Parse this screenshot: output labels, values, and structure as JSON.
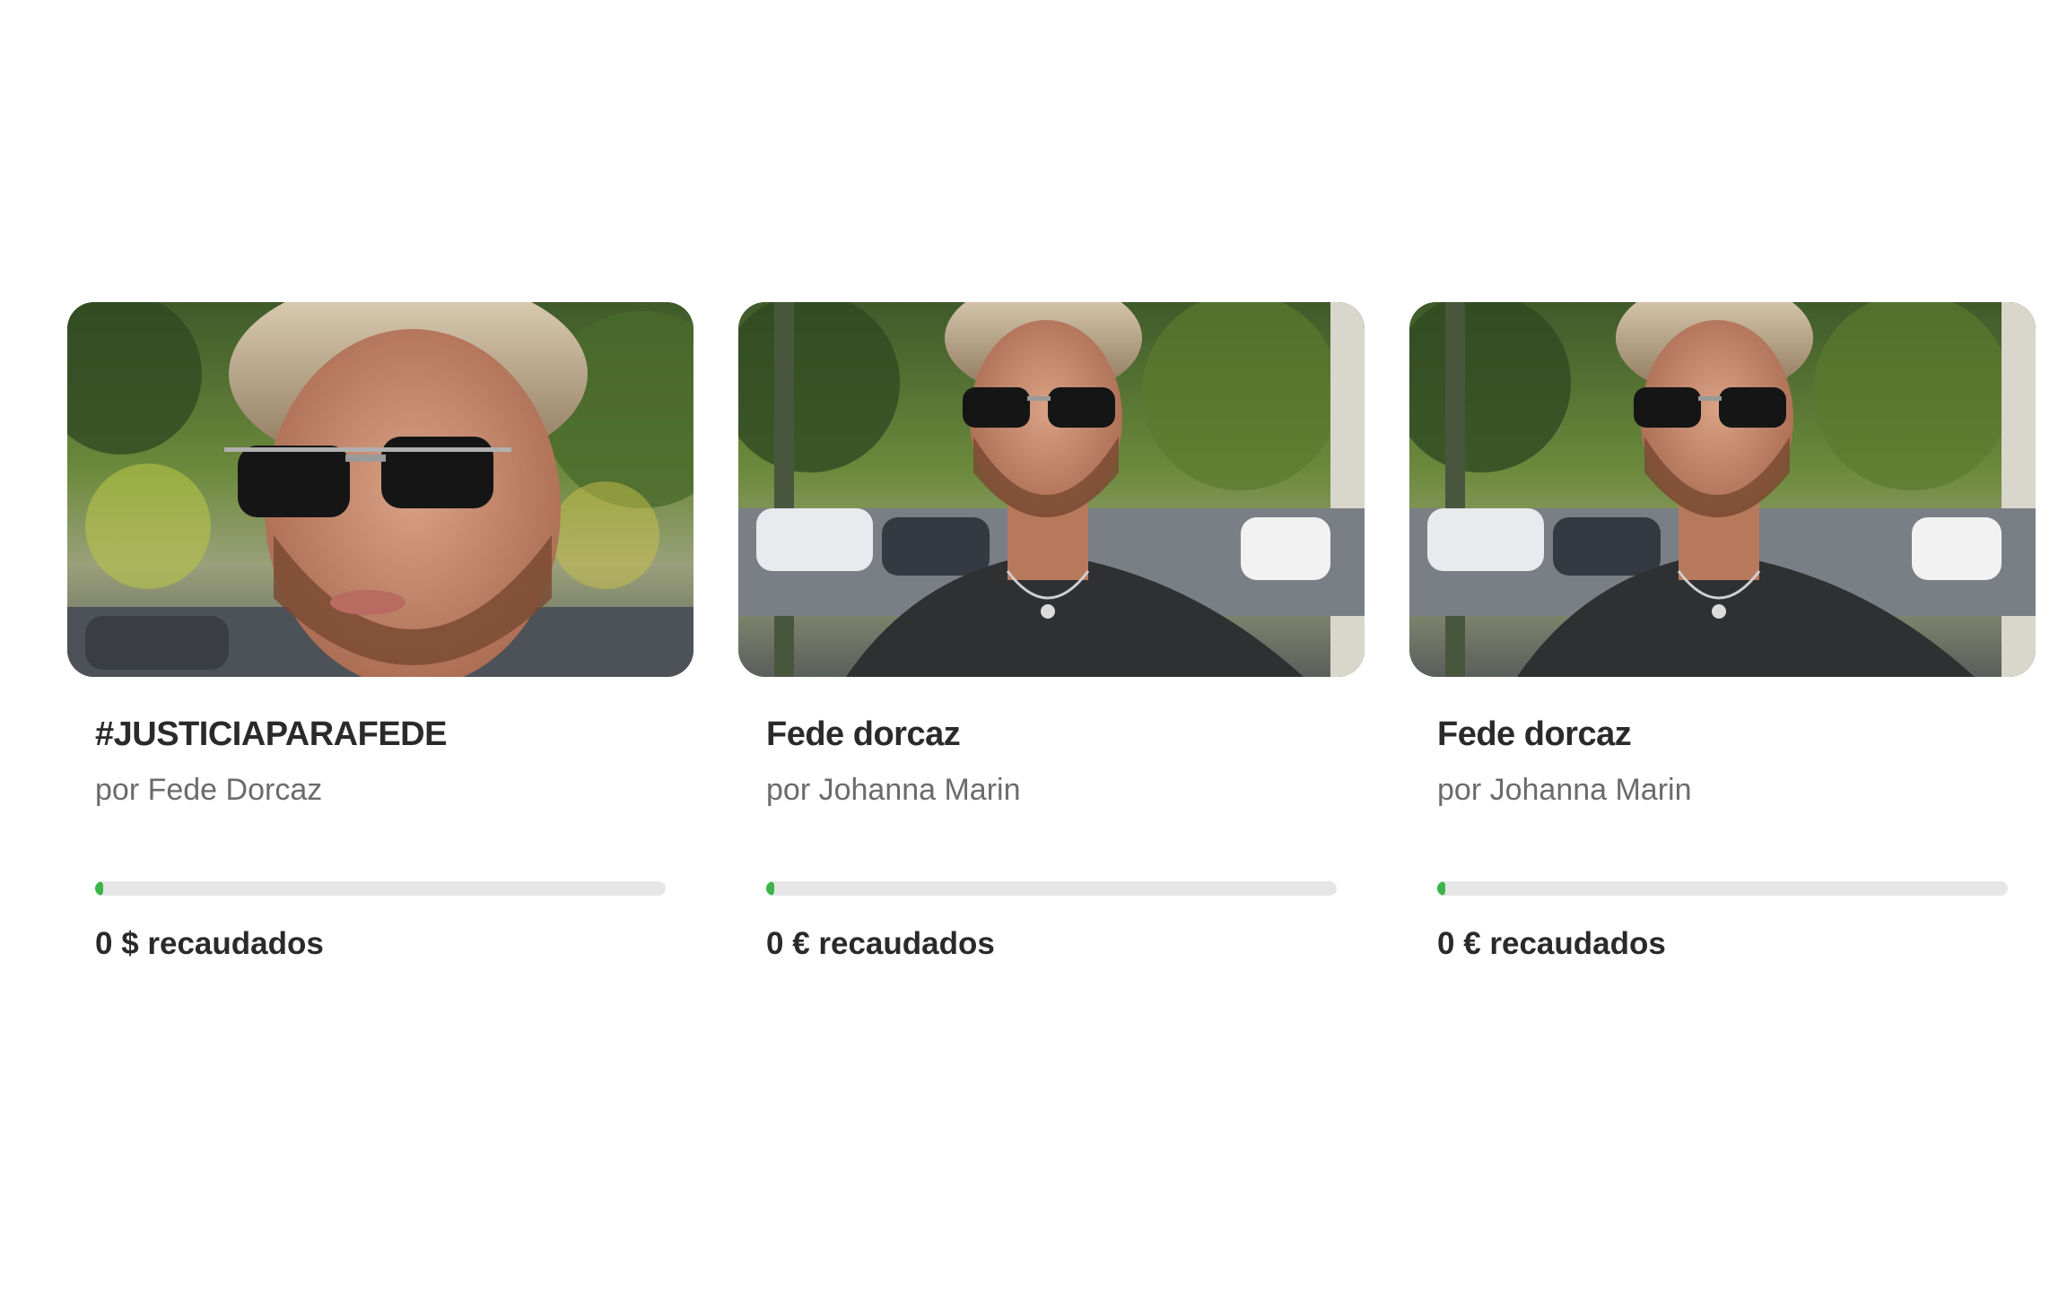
{
  "colors": {
    "progress_fill": "#3bb54a",
    "progress_track": "#e6e6e6",
    "title": "#2a2a2a",
    "byline": "#6b6b6b"
  },
  "cards": [
    {
      "title": "#JUSTICIAPARAFEDE",
      "byline": "por Fede Dorcaz",
      "raised_label": "0 $ recaudados",
      "progress": 0
    },
    {
      "title": "Fede dorcaz",
      "byline": "por Johanna Marin",
      "raised_label": "0 € recaudados",
      "progress": 0
    },
    {
      "title": "Fede dorcaz",
      "byline": "por Johanna Marin",
      "raised_label": "0 € recaudados",
      "progress": 0
    }
  ]
}
